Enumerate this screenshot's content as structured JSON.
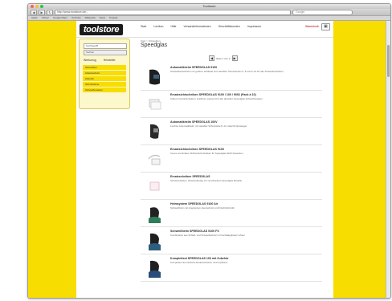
{
  "browser": {
    "title": "Toolstore",
    "url": "http://www.toolstore.de/...",
    "search_placeholder": "Google",
    "back": "◀",
    "forward": "▶",
    "reload": "↻",
    "bookmarks": [
      "Apple",
      "Yahoo!",
      "Google Maps",
      "YouTube",
      "Wikipedia",
      "News",
      "Popular"
    ]
  },
  "site": {
    "logo": "toolstore",
    "nav": [
      "Start",
      "Lexikon",
      "Hilfe",
      "Versandinformationen",
      "Geschäftskunden",
      "Impressum"
    ],
    "cart": "Warenkorb",
    "cart_icon": "cart-icon"
  },
  "sidebar": {
    "search_placeholder": "Suchbegriff",
    "search_button": "Suchen",
    "tabs": [
      "Werkzeug",
      "Hersteller"
    ],
    "items": [
      "Schweißen",
      "Arbeitsschutz",
      "Zubehör",
      "Schutzhelme",
      "Schweißmasken"
    ]
  },
  "content": {
    "breadcrumb": "Start > Schweißen",
    "title": "Speedglas",
    "pager": {
      "prev": "◀",
      "text": "Seite 1 von 2",
      "next": "▶"
    },
    "products": [
      {
        "name": "Automatikhelm SPEEDGLAS 9100",
        "desc": "Schweißschutzhelm mit großem Sichtfeld und variablen Schutzstufen 5, 8 und 9–13 für alle Schweißverfahren."
      },
      {
        "name": "Ersatzsichtscheiben SPEEDGLAS 9100 / 100 / 9002 (Pack à 10)",
        "desc": "Äußere Vorsatzscheiben, kratzfest, passend für alle aktuellen Speedglas Schweißmasken."
      },
      {
        "name": "Automatikhelm SPEEDGLAS 100V",
        "desc": "Leichter Automatikhelm mit variabler Schutzstufe 8–12, ideal für Einsteiger."
      },
      {
        "name": "Ersatzsichtscheiben SPEEDGLAS 9100",
        "desc": "Innere und äußere Sichtschutzscheiben für Speedglas 9100 Kassetten."
      },
      {
        "name": "Ersatzscheiben SPEEDGLAS",
        "desc": "Schutzscheiben, hitzebeständig, für verschiedene Speedglas Modelle."
      },
      {
        "name": "Helmsystem SPEEDGLAS 9100 Air",
        "desc": "Schweißhelm mit integriertem Atemschutz und Frischluftzufuhr."
      },
      {
        "name": "Schweißhelm SPEEDGLAS 9100 FX",
        "desc": "Kombination aus Schleif- und Schweißschutz mit hochklappbarem Visier."
      },
      {
        "name": "Komplettset SPEEDGLAS 100 mit Zubehör",
        "desc": "Komplettes Set inklusive Ersatzscheiben und Kopfband."
      }
    ]
  },
  "colors": {
    "background": "#f7dd00",
    "logo_bg": "#1a1a1a",
    "cart_text": "#c00000"
  }
}
